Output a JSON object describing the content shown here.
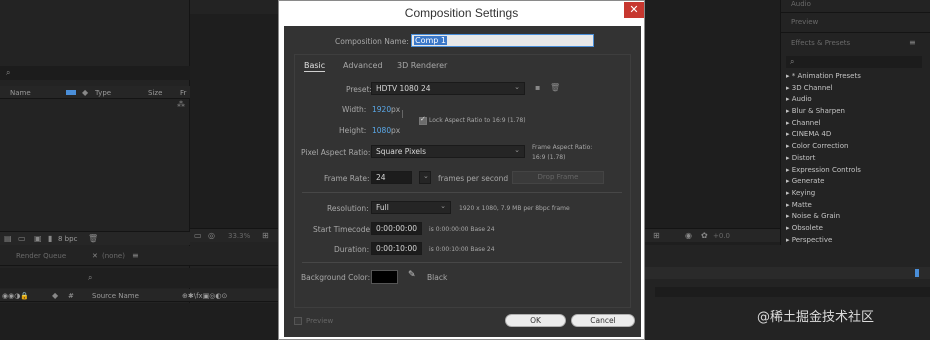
{
  "app": {
    "project": {
      "columns": [
        "Name",
        "Type",
        "Size",
        "Fr"
      ],
      "footer_bpc": "8 bpc"
    },
    "effects_panel": {
      "title_audio": "Audio",
      "title_preview": "Preview",
      "title_effects": "Effects & Presets",
      "items": [
        "▸ * Animation Presets",
        "▸ 3D Channel",
        "▸ Audio",
        "▸ Blur & Sharpen",
        "▸ Channel",
        "▸ CINEMA 4D",
        "▸ Color Correction",
        "▸ Distort",
        "▸ Expression Controls",
        "▸ Generate",
        "▸ Keying",
        "▸ Matte",
        "▸ Noise & Grain",
        "▸ Obsolete",
        "▸ Perspective"
      ]
    },
    "comp_toolbar": {
      "zoom": "33.3%",
      "time_right": "+0.0"
    },
    "timeline": {
      "tab_render_queue": "Render Queue",
      "tab_none": "(none)",
      "col_hash": "#",
      "col_source_name": "Source Name"
    }
  },
  "dialog": {
    "title": "Composition Settings",
    "close_label": "✕",
    "comp_name_label": "Composition Name:",
    "comp_name_value": "Comp 1",
    "tabs": [
      "Basic",
      "Advanced",
      "3D Renderer"
    ],
    "preset_label": "Preset:",
    "preset_value": "HDTV 1080 24",
    "width_label": "Width:",
    "width_value": "1920",
    "width_unit": "px",
    "height_label": "Height:",
    "height_value": "1080",
    "height_unit": "px",
    "lock_aspect_label": "Lock Aspect Ratio to 16:9 (1.78)",
    "par_label": "Pixel Aspect Ratio:",
    "par_value": "Square Pixels",
    "frame_aspect_label": "Frame Aspect Ratio:",
    "frame_aspect_value": "16:9 (1.78)",
    "frame_rate_label": "Frame Rate:",
    "frame_rate_value": "24",
    "frame_rate_unit": "frames per second",
    "drop_frame": "Drop Frame",
    "resolution_label": "Resolution:",
    "resolution_value": "Full",
    "resolution_info": "1920 x 1080, 7.9 MB per 8bpc frame",
    "start_tc_label": "Start Timecode:",
    "start_tc_value": "0:00:00:00",
    "start_tc_info": "is 0:00:00:00  Base 24",
    "duration_label": "Duration:",
    "duration_value": "0:00:10:00",
    "duration_info": "is 0:00:10:00  Base 24",
    "bg_color_label": "Background Color:",
    "bg_color_value": "#000000",
    "bg_color_name": "Black",
    "preview_label": "Preview",
    "ok_label": "OK",
    "cancel_label": "Cancel"
  },
  "watermark": "@稀土掘金技术社区",
  "colors": {
    "accent_blue": "#5aa8e8",
    "close_red": "#c7372f",
    "dialog_bg": "#333333"
  }
}
